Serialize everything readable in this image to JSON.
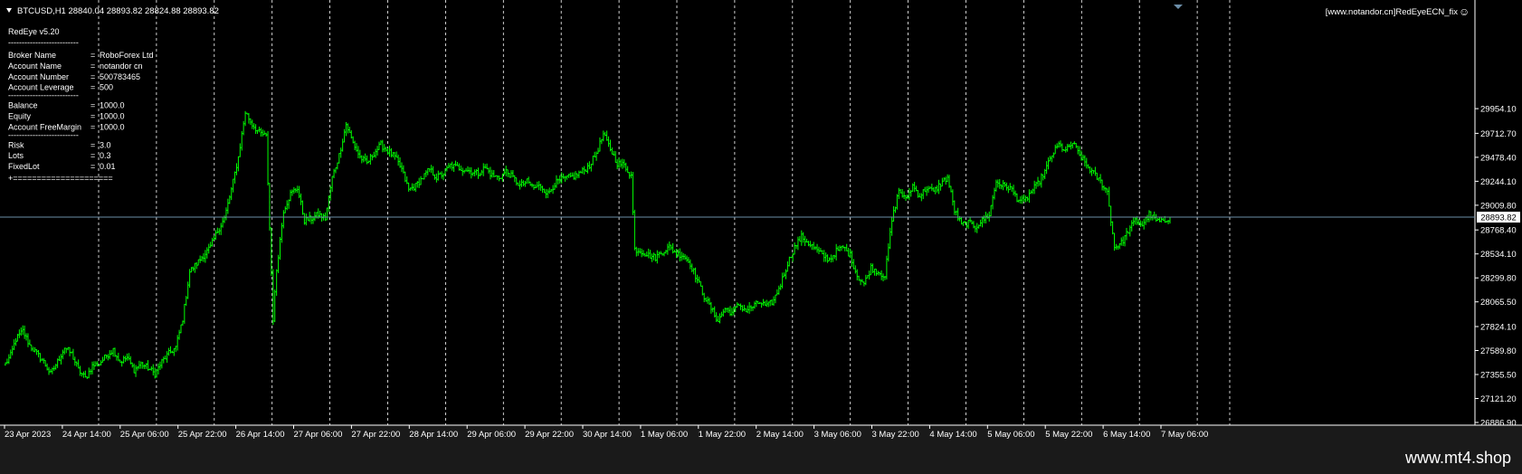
{
  "header": {
    "symbol_line": "BTCUSD,H1  28840.04 28893.82 28824.88 28893.82",
    "ea_label": "[www.notandor.cn]RedEyeECN_fix",
    "smiley": "☺"
  },
  "info_panel": {
    "title": "RedEye v5.20",
    "rows": [
      {
        "label": "Broker Name",
        "value": "RoboForex Ltd",
        "group": 1
      },
      {
        "label": "Account Name",
        "value": "notandor cn",
        "group": 1
      },
      {
        "label": "Account Number",
        "value": "500783465",
        "group": 1
      },
      {
        "label": "Account Leverage",
        "value": "500",
        "group": 1
      },
      {
        "label": "Balance",
        "value": "1000.0",
        "group": 2
      },
      {
        "label": "Equity",
        "value": "1000.0",
        "group": 2
      },
      {
        "label": "Account FreeMargin",
        "value": "1000.0",
        "group": 2
      },
      {
        "label": "Risk",
        "value": "3.0",
        "group": 3
      },
      {
        "label": "Lots",
        "value": "0.3",
        "group": 3
      },
      {
        "label": "FixedLot",
        "value": "0.01",
        "group": 3
      }
    ],
    "separator_dashes": "--------------------------",
    "footer_separator": "+====================="
  },
  "watermark": "www.mt4.shop",
  "colors": {
    "background": "#000000",
    "candle": "#00ff00",
    "grid": "#ffffff",
    "price_line": "#6c8ea8",
    "outer": "#1a1a1a"
  },
  "chart_data": {
    "type": "candlestick",
    "symbol": "BTCUSD",
    "timeframe": "H1",
    "current_price": 28893.82,
    "current_price_label": "28893.82",
    "y_ticks": [
      "29954.10",
      "29712.70",
      "29478.40",
      "29244.10",
      "29009.80",
      "28768.40",
      "28534.10",
      "28299.80",
      "28065.50",
      "27824.10",
      "27589.80",
      "27355.50",
      "27121.20",
      "26886.90"
    ],
    "y_range": [
      26886.9,
      30050
    ],
    "x_ticks": [
      "23 Apr 2023",
      "24 Apr 14:00",
      "25 Apr 06:00",
      "25 Apr 22:00",
      "26 Apr 14:00",
      "27 Apr 06:00",
      "27 Apr 22:00",
      "28 Apr 14:00",
      "29 Apr 06:00",
      "29 Apr 22:00",
      "30 Apr 14:00",
      "1 May 06:00",
      "1 May 22:00",
      "2 May 14:00",
      "3 May 06:00",
      "3 May 22:00",
      "4 May 14:00",
      "5 May 06:00",
      "5 May 22:00",
      "6 May 14:00",
      "7 May 06:00"
    ],
    "close_anchors": [
      [
        0,
        27460
      ],
      [
        3,
        27540
      ],
      [
        6,
        27700
      ],
      [
        10,
        27780
      ],
      [
        14,
        27640
      ],
      [
        18,
        27560
      ],
      [
        22,
        27480
      ],
      [
        26,
        27360
      ],
      [
        30,
        27480
      ],
      [
        34,
        27620
      ],
      [
        38,
        27560
      ],
      [
        42,
        27400
      ],
      [
        46,
        27320
      ],
      [
        50,
        27440
      ],
      [
        54,
        27460
      ],
      [
        58,
        27540
      ],
      [
        62,
        27600
      ],
      [
        66,
        27480
      ],
      [
        70,
        27520
      ],
      [
        74,
        27400
      ],
      [
        78,
        27460
      ],
      [
        82,
        27420
      ],
      [
        86,
        27360
      ],
      [
        90,
        27480
      ],
      [
        94,
        27560
      ],
      [
        98,
        27620
      ],
      [
        102,
        27900
      ],
      [
        106,
        28360
      ],
      [
        110,
        28440
      ],
      [
        114,
        28520
      ],
      [
        118,
        28600
      ],
      [
        122,
        28760
      ],
      [
        126,
        28880
      ],
      [
        130,
        29160
      ],
      [
        134,
        29480
      ],
      [
        138,
        29920
      ],
      [
        142,
        29800
      ],
      [
        146,
        29720
      ],
      [
        150,
        29680
      ],
      [
        154,
        27900
      ],
      [
        156,
        28380
      ],
      [
        160,
        28960
      ],
      [
        164,
        29120
      ],
      [
        168,
        29180
      ],
      [
        172,
        28860
      ],
      [
        176,
        28880
      ],
      [
        180,
        28920
      ],
      [
        184,
        28880
      ],
      [
        188,
        29280
      ],
      [
        192,
        29500
      ],
      [
        196,
        29800
      ],
      [
        200,
        29620
      ],
      [
        204,
        29480
      ],
      [
        208,
        29420
      ],
      [
        212,
        29520
      ],
      [
        216,
        29600
      ],
      [
        220,
        29540
      ],
      [
        224,
        29480
      ],
      [
        228,
        29360
      ],
      [
        232,
        29160
      ],
      [
        236,
        29200
      ],
      [
        240,
        29280
      ],
      [
        244,
        29360
      ],
      [
        248,
        29280
      ],
      [
        252,
        29320
      ],
      [
        256,
        29400
      ],
      [
        260,
        29380
      ],
      [
        264,
        29360
      ],
      [
        268,
        29340
      ],
      [
        272,
        29320
      ],
      [
        276,
        29380
      ],
      [
        280,
        29300
      ],
      [
        284,
        29280
      ],
      [
        288,
        29340
      ],
      [
        292,
        29280
      ],
      [
        296,
        29200
      ],
      [
        300,
        29240
      ],
      [
        304,
        29180
      ],
      [
        308,
        29200
      ],
      [
        312,
        29120
      ],
      [
        316,
        29220
      ],
      [
        320,
        29260
      ],
      [
        324,
        29280
      ],
      [
        328,
        29300
      ],
      [
        332,
        29340
      ],
      [
        336,
        29400
      ],
      [
        340,
        29520
      ],
      [
        344,
        29700
      ],
      [
        348,
        29560
      ],
      [
        352,
        29420
      ],
      [
        356,
        29400
      ],
      [
        360,
        29300
      ],
      [
        362,
        28580
      ],
      [
        366,
        28560
      ],
      [
        370,
        28520
      ],
      [
        374,
        28500
      ],
      [
        378,
        28560
      ],
      [
        382,
        28600
      ],
      [
        386,
        28540
      ],
      [
        390,
        28520
      ],
      [
        394,
        28440
      ],
      [
        398,
        28280
      ],
      [
        402,
        28120
      ],
      [
        406,
        28000
      ],
      [
        410,
        27880
      ],
      [
        414,
        28000
      ],
      [
        418,
        27960
      ],
      [
        422,
        28040
      ],
      [
        426,
        27980
      ],
      [
        430,
        28020
      ],
      [
        434,
        28060
      ],
      [
        438,
        28020
      ],
      [
        442,
        28080
      ],
      [
        446,
        28240
      ],
      [
        450,
        28440
      ],
      [
        454,
        28600
      ],
      [
        458,
        28700
      ],
      [
        462,
        28640
      ],
      [
        466,
        28580
      ],
      [
        470,
        28520
      ],
      [
        474,
        28480
      ],
      [
        478,
        28560
      ],
      [
        482,
        28600
      ],
      [
        486,
        28520
      ],
      [
        490,
        28320
      ],
      [
        494,
        28240
      ],
      [
        498,
        28400
      ],
      [
        502,
        28360
      ],
      [
        506,
        28320
      ],
      [
        510,
        28860
      ],
      [
        514,
        29160
      ],
      [
        518,
        29060
      ],
      [
        522,
        29200
      ],
      [
        526,
        29100
      ],
      [
        530,
        29180
      ],
      [
        534,
        29140
      ],
      [
        538,
        29220
      ],
      [
        542,
        29280
      ],
      [
        546,
        28960
      ],
      [
        550,
        28820
      ],
      [
        554,
        28840
      ],
      [
        558,
        28800
      ],
      [
        562,
        28860
      ],
      [
        566,
        28920
      ],
      [
        570,
        29240
      ],
      [
        574,
        29200
      ],
      [
        578,
        29180
      ],
      [
        582,
        29080
      ],
      [
        586,
        29040
      ],
      [
        590,
        29140
      ],
      [
        594,
        29220
      ],
      [
        598,
        29340
      ],
      [
        602,
        29500
      ],
      [
        606,
        29600
      ],
      [
        610,
        29540
      ],
      [
        614,
        29620
      ],
      [
        618,
        29500
      ],
      [
        622,
        29400
      ],
      [
        626,
        29320
      ],
      [
        630,
        29240
      ],
      [
        634,
        29140
      ],
      [
        638,
        28600
      ],
      [
        642,
        28640
      ],
      [
        646,
        28760
      ],
      [
        650,
        28860
      ],
      [
        654,
        28820
      ],
      [
        658,
        28920
      ],
      [
        662,
        28860
      ],
      [
        666,
        28840
      ],
      [
        670,
        28893.82
      ]
    ]
  }
}
